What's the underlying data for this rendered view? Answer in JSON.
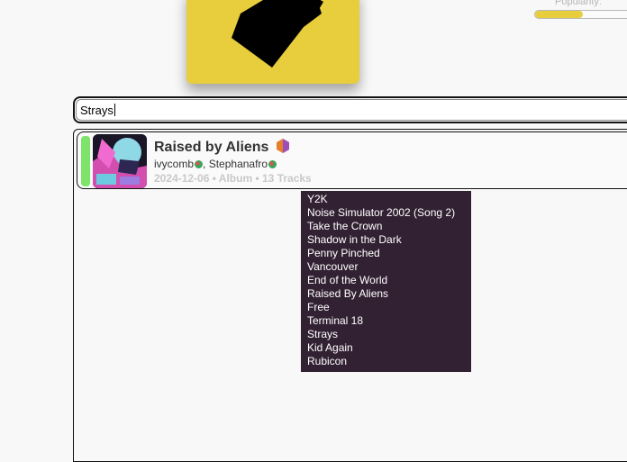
{
  "header": {
    "popularity_label": "Popularity:",
    "popularity_value": 0.48
  },
  "search": {
    "value": "Strays"
  },
  "result": {
    "title": "Raised by Aliens",
    "artists": [
      {
        "name": "ivycomb"
      },
      {
        "name": "Stephanafro"
      }
    ],
    "artist_separator": ",",
    "meta": "2024-12-06 • Album • 13 Tracks",
    "tracks": [
      "Y2K",
      "Noise Simulator 2002 (Song 2)",
      "Take the Crown",
      "Shadow in the Dark",
      "Penny Pinched",
      "Vancouver",
      "End of the World",
      "Raised By Aliens",
      "Free",
      "Terminal 18",
      "Strays",
      "Kid Again",
      "Rubicon"
    ]
  },
  "colors": {
    "accent_yellow": "#e8cd3c",
    "status_green": "#7ee36b",
    "tooltip_bg": "#322133",
    "meta_gray": "#c8c8c8"
  },
  "icons": {
    "album_type": "hexagon-icon",
    "artist_badge": "artist-badge-icon"
  }
}
